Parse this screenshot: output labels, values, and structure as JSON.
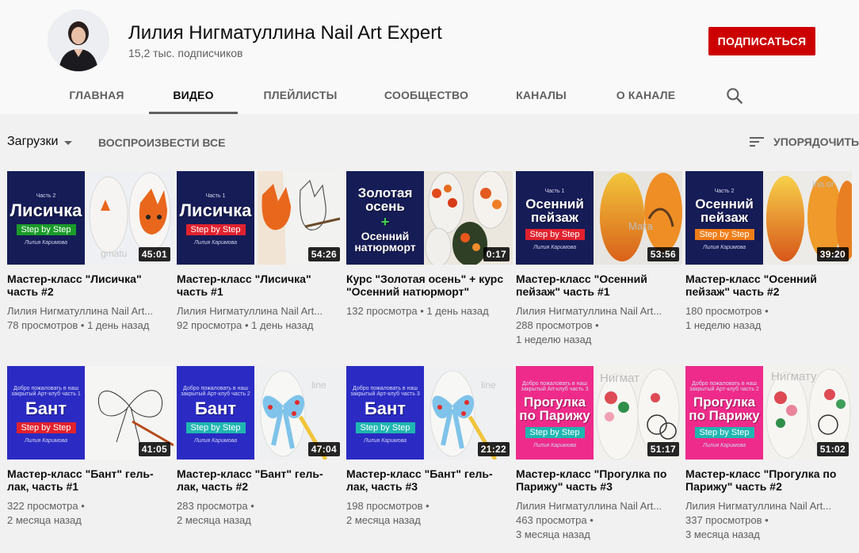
{
  "channel": {
    "name": "Лилия Нигматуллина Nail Art Expert",
    "subscribers": "15,2 тыс. подписчиков",
    "subscribe_label": "ПОДПИСАТЬСЯ"
  },
  "tabs": [
    {
      "label": "ГЛАВНАЯ"
    },
    {
      "label": "ВИДЕО"
    },
    {
      "label": "ПЛЕЙЛИСТЫ"
    },
    {
      "label": "СООБЩЕСТВО"
    },
    {
      "label": "КАНАЛЫ"
    },
    {
      "label": "О КАНАЛЕ"
    }
  ],
  "active_tab": "ВИДЕО",
  "toolbar": {
    "uploads_label": "Загрузки",
    "play_all_label": "ВОСПРОИЗВЕСТИ ВСЕ",
    "sort_label": "УПОРЯДОЧИТЬ"
  },
  "colors": {
    "subscribe": "#cc0000",
    "navy": "#161c56",
    "blue": "#2b2bc4",
    "pink": "#ee2b8a",
    "green": "#1a9b2a",
    "red": "#e0222e",
    "teal": "#1fb6b1",
    "orange": "#ef7d18"
  },
  "videos": [
    {
      "title": "Мастер-класс \"Лисичка\" часть #2",
      "channel": "Лилия Нигматуллина Nail Art...",
      "views": "78 просмотров",
      "age": "1 день назад",
      "duration": "45:01",
      "thumb": {
        "heading": "Лисичка",
        "sub": "Часть 2",
        "badge": "Step by Step",
        "top": "",
        "sig": "Лилия Каримова",
        "style": "navy",
        "badge_color": "green",
        "art": "fox"
      }
    },
    {
      "title": "Мастер-класс \"Лисичка\" часть #1",
      "channel": "Лилия Нигматуллина Nail Art...",
      "views": "92 просмотра",
      "age": "1 день назад",
      "duration": "54:26",
      "thumb": {
        "heading": "Лисичка",
        "sub": "Часть 1",
        "badge": "Step by Step",
        "top": "",
        "sig": "Лилия Каримова",
        "style": "navy",
        "badge_color": "red",
        "art": "sketch-fox"
      }
    },
    {
      "title": "Курс \"Золотая осень\" + курс \"Осенний натюрморт\"",
      "channel": "",
      "views": "132 просмотра",
      "age": "1 день назад",
      "duration": "0:17",
      "thumb": {
        "heading": "Золотая осень",
        "sub": "",
        "badge": "",
        "plus": "+",
        "heading2": "Осенний натюрморт",
        "top": "",
        "sig": "",
        "style": "navy",
        "badge_color": "",
        "art": "still-life"
      }
    },
    {
      "title": "Мастер-класс \"Осенний пейзаж\" часть #1",
      "channel": "Лилия Нигматуллина Nail Art...",
      "views": "288 просмотров",
      "age": "1 неделю назад",
      "duration": "53:56",
      "thumb": {
        "heading": "Осенний пейзаж",
        "sub": "Часть 1",
        "badge": "Step by Step",
        "top": "",
        "sig": "Лилия Каримова",
        "style": "navy",
        "badge_color": "red",
        "art": "autumn"
      }
    },
    {
      "title": "Мастер-класс \"Осенний пейзаж\" часть #2",
      "channel": "",
      "views": "180 просмотров",
      "age": "1 неделю назад",
      "duration": "39:20",
      "thumb": {
        "heading": "Осенний пейзаж",
        "sub": "Часть 2",
        "badge": "Step by Step",
        "top": "",
        "sig": "Лилия Каримова",
        "style": "navy",
        "badge_color": "orange",
        "art": "autumn2"
      }
    },
    {
      "title": "Мастер-класс \"Бант\" гель-лак, часть #1",
      "channel": "",
      "views": "322 просмотра",
      "age": "2 месяца назад",
      "duration": "41:05",
      "thumb": {
        "heading": "Бант",
        "sub": "",
        "badge": "Step by Step",
        "top": "Добро пожаловать в наш закрытый Арт-клуб часть 1",
        "sig": "Лилия Каримова",
        "style": "blue",
        "badge_color": "red",
        "art": "bow-sketch"
      }
    },
    {
      "title": "Мастер-класс \"Бант\" гель-лак, часть #2",
      "channel": "",
      "views": "283 просмотра",
      "age": "2 месяца назад",
      "duration": "47:04",
      "thumb": {
        "heading": "Бант",
        "sub": "",
        "badge": "Step by Step",
        "top": "Добро пожаловать в наш закрытый Арт-клуб часть 2",
        "sig": "Лилия Каримова",
        "style": "blue",
        "badge_color": "teal",
        "art": "bow"
      }
    },
    {
      "title": "Мастер-класс \"Бант\" гель-лак, часть #3",
      "channel": "",
      "views": "198 просмотров",
      "age": "2 месяца назад",
      "duration": "21:22",
      "thumb": {
        "heading": "Бант",
        "sub": "",
        "badge": "Step by Step",
        "top": "Добро пожаловать в наш закрытый Арт-клуб часть 3",
        "sig": "Лилия Каримова",
        "style": "blue",
        "badge_color": "teal",
        "art": "bow"
      }
    },
    {
      "title": "Мастер-класс \"Прогулка по Парижу\" часть #3",
      "channel": "Лилия Нигматуллина Nail Art...",
      "views": "463 просмотра",
      "age": "3 месяца назад",
      "duration": "51:17",
      "thumb": {
        "heading": "Прогулка по Парижу",
        "sub": "",
        "badge": "Step by Step",
        "top": "Добро пожаловать в наш закрытый Art-клуб часть 3",
        "sig": "Лилия Каримова",
        "style": "pink",
        "badge_color": "teal",
        "art": "paris"
      }
    },
    {
      "title": "Мастер-класс \"Прогулка по Парижу\" часть #2",
      "channel": "Лилия Нигматуллина Nail Art...",
      "views": "337 просмотров",
      "age": "3 месяца назад",
      "duration": "51:02",
      "thumb": {
        "heading": "Прогулка по Парижу",
        "sub": "",
        "badge": "Step by Step",
        "top": "Добро пожаловать в наш закрытый Арт-клуб часть 2",
        "sig": "Лилия Каримова",
        "style": "pink",
        "badge_color": "teal",
        "art": "paris2"
      }
    }
  ]
}
